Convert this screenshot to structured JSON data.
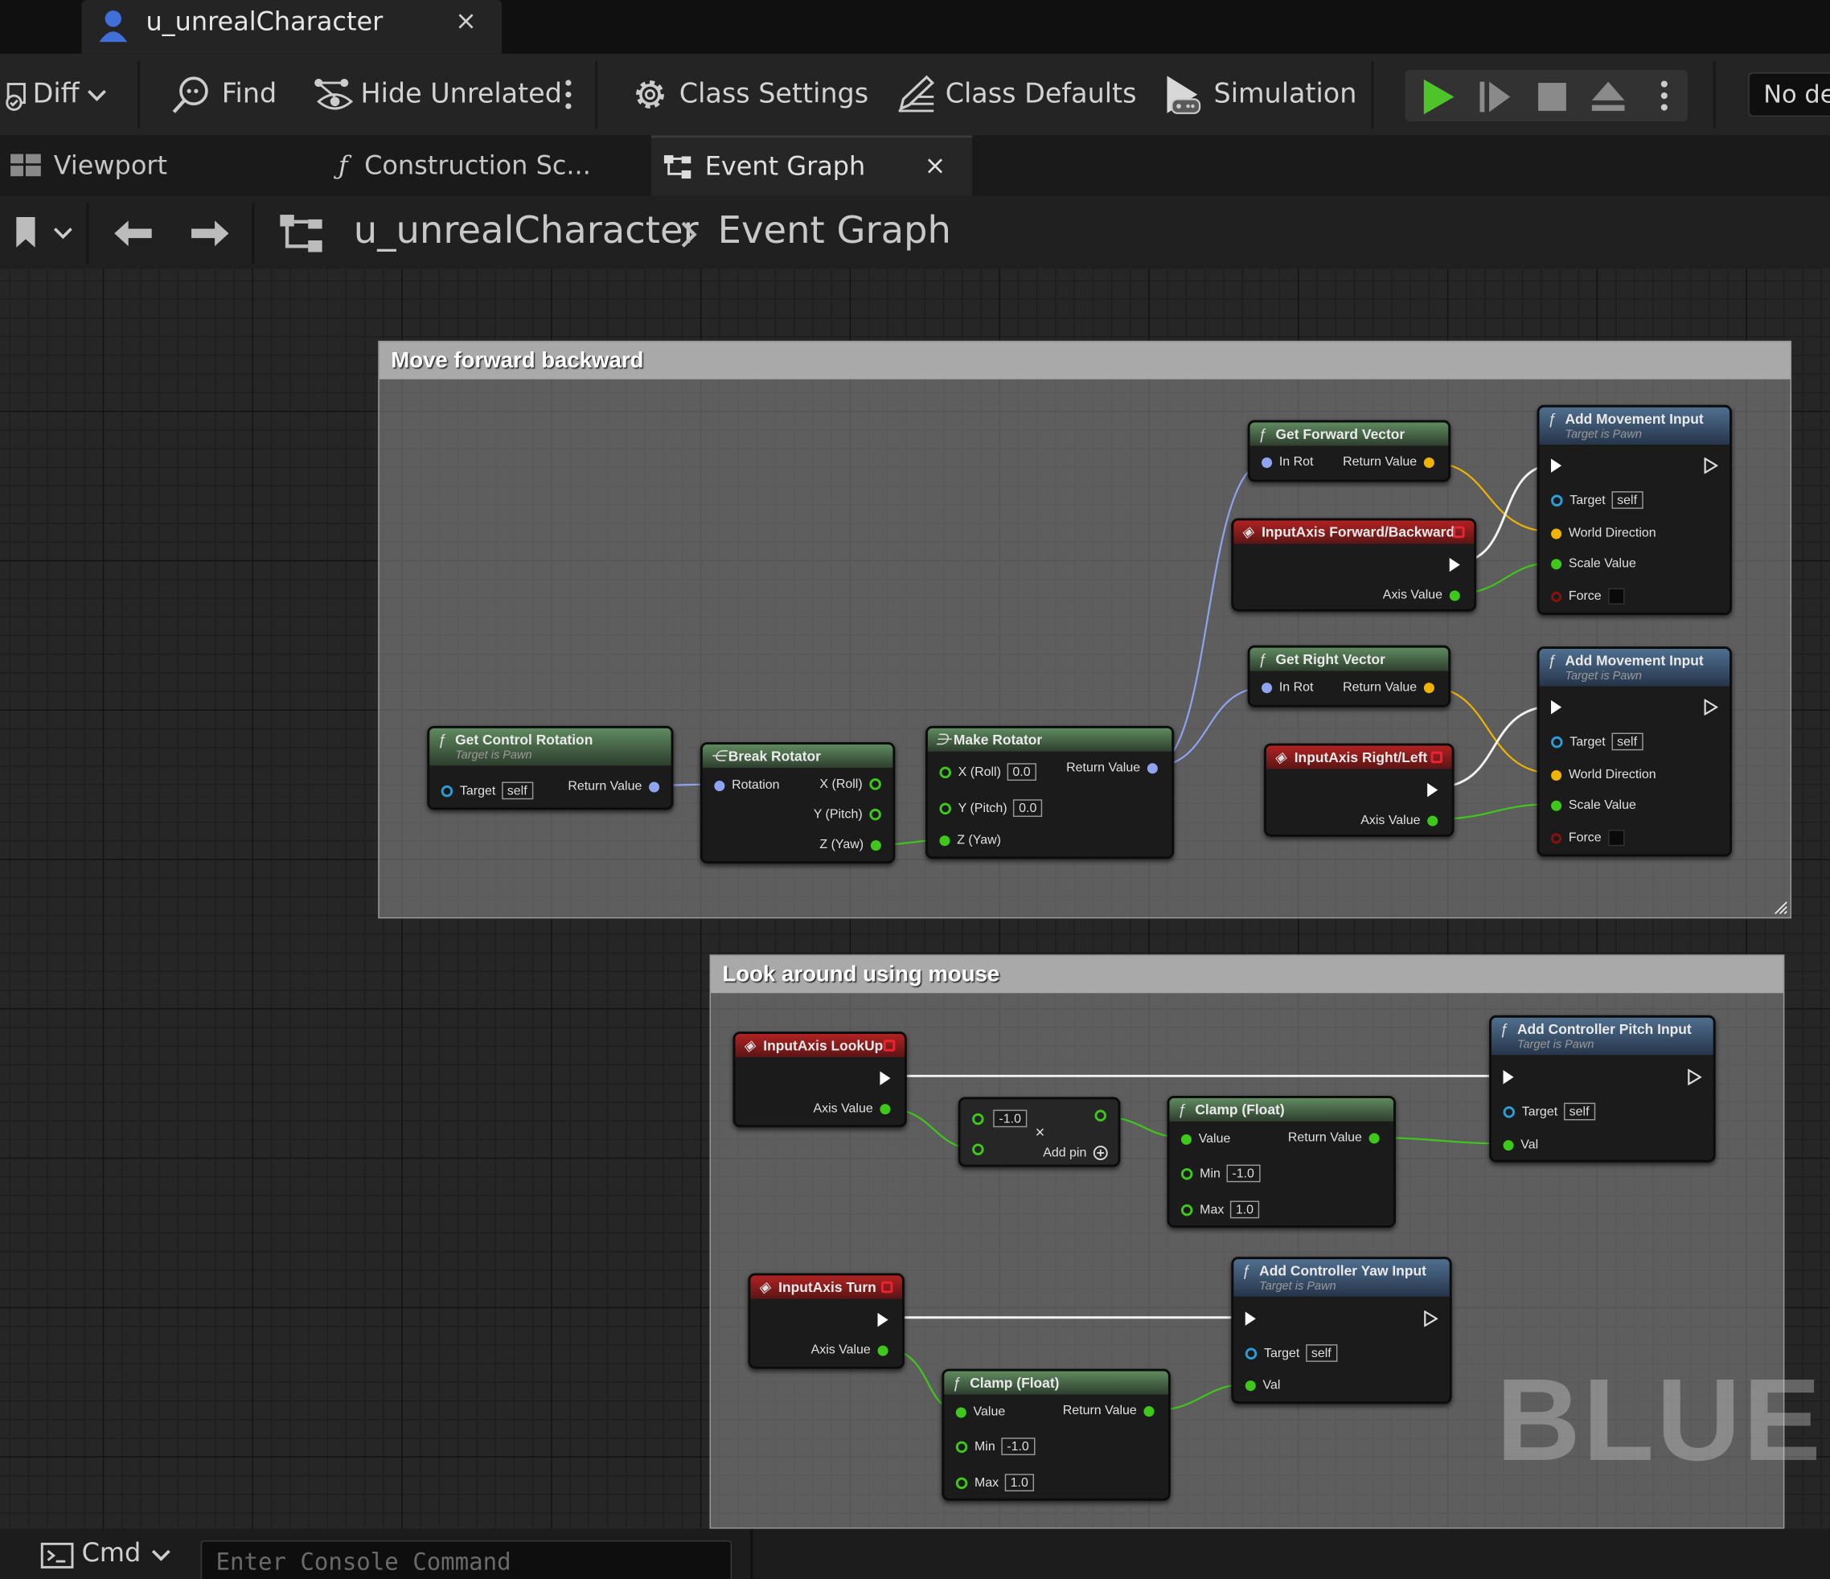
{
  "document_tab": {
    "title": "u_unrealCharacter",
    "close": "×"
  },
  "toolbar": {
    "diff": "Diff",
    "find": "Find",
    "hide_unrelated": "Hide Unrelated",
    "class_settings": "Class Settings",
    "class_defaults": "Class Defaults",
    "simulation": "Simulation",
    "debug_filter": "No de"
  },
  "tabs": [
    {
      "label": "Viewport"
    },
    {
      "label": "Construction Sc..."
    },
    {
      "label": "Event Graph",
      "close": "×"
    }
  ],
  "breadcrumb": {
    "root": "u_unrealCharacter",
    "current": "Event Graph"
  },
  "comments": {
    "move": "Move forward backward",
    "look": "Look around using mouse"
  },
  "nodes": {
    "get_control_rotation": {
      "title": "Get Control Rotation",
      "subtitle": "Target is Pawn",
      "target": "Target",
      "target_val": "self",
      "ret": "Return Value"
    },
    "break_rotator": {
      "title": "Break Rotator",
      "rotation": "Rotation",
      "x": "X (Roll)",
      "y": "Y (Pitch)",
      "z": "Z (Yaw)"
    },
    "make_rotator": {
      "title": "Make Rotator",
      "x": "X (Roll)",
      "x_val": "0.0",
      "y": "Y (Pitch)",
      "y_val": "0.0",
      "z": "Z (Yaw)",
      "ret": "Return Value"
    },
    "get_forward_vector": {
      "title": "Get Forward Vector",
      "in": "In Rot",
      "ret": "Return Value"
    },
    "input_fb": {
      "title": "InputAxis Forward/Backward",
      "axis": "Axis Value"
    },
    "add_move_1": {
      "title": "Add Movement Input",
      "subtitle": "Target is Pawn",
      "target": "Target",
      "target_val": "self",
      "world": "World Direction",
      "scale": "Scale Value",
      "force": "Force"
    },
    "get_right_vector": {
      "title": "Get Right Vector",
      "in": "In Rot",
      "ret": "Return Value"
    },
    "input_rl": {
      "title": "InputAxis Right/Left",
      "axis": "Axis Value"
    },
    "add_move_2": {
      "title": "Add Movement Input",
      "subtitle": "Target is Pawn",
      "target": "Target",
      "target_val": "self",
      "world": "World Direction",
      "scale": "Scale Value",
      "force": "Force"
    },
    "input_lookup": {
      "title": "InputAxis LookUp",
      "axis": "Axis Value"
    },
    "multiply": {
      "val": "-1.0",
      "add_pin": "Add pin"
    },
    "clamp_1": {
      "title": "Clamp (Float)",
      "value": "Value",
      "ret": "Return Value",
      "min": "Min",
      "min_val": "-1.0",
      "max": "Max",
      "max_val": "1.0"
    },
    "add_pitch": {
      "title": "Add Controller Pitch Input",
      "subtitle": "Target is Pawn",
      "target": "Target",
      "target_val": "self",
      "val": "Val"
    },
    "input_turn": {
      "title": "InputAxis Turn",
      "axis": "Axis Value"
    },
    "clamp_2": {
      "title": "Clamp (Float)",
      "value": "Value",
      "ret": "Return Value",
      "min": "Min",
      "min_val": "-1.0",
      "max": "Max",
      "max_val": "1.0"
    },
    "add_yaw": {
      "title": "Add Controller Yaw Input",
      "subtitle": "Target is Pawn",
      "target": "Target",
      "target_val": "self",
      "val": "Val"
    }
  },
  "watermark": "BLUEP",
  "console": {
    "cmd": "Cmd",
    "placeholder": "Enter Console Command"
  },
  "colors": {
    "accent_play": "#4fc32a",
    "struct_pin": "#8ea4f0",
    "vector_pin": "#f0b400",
    "float_pin": "#3ec81a",
    "object_pin": "#2a9ed8",
    "input_event": "#b02222"
  }
}
